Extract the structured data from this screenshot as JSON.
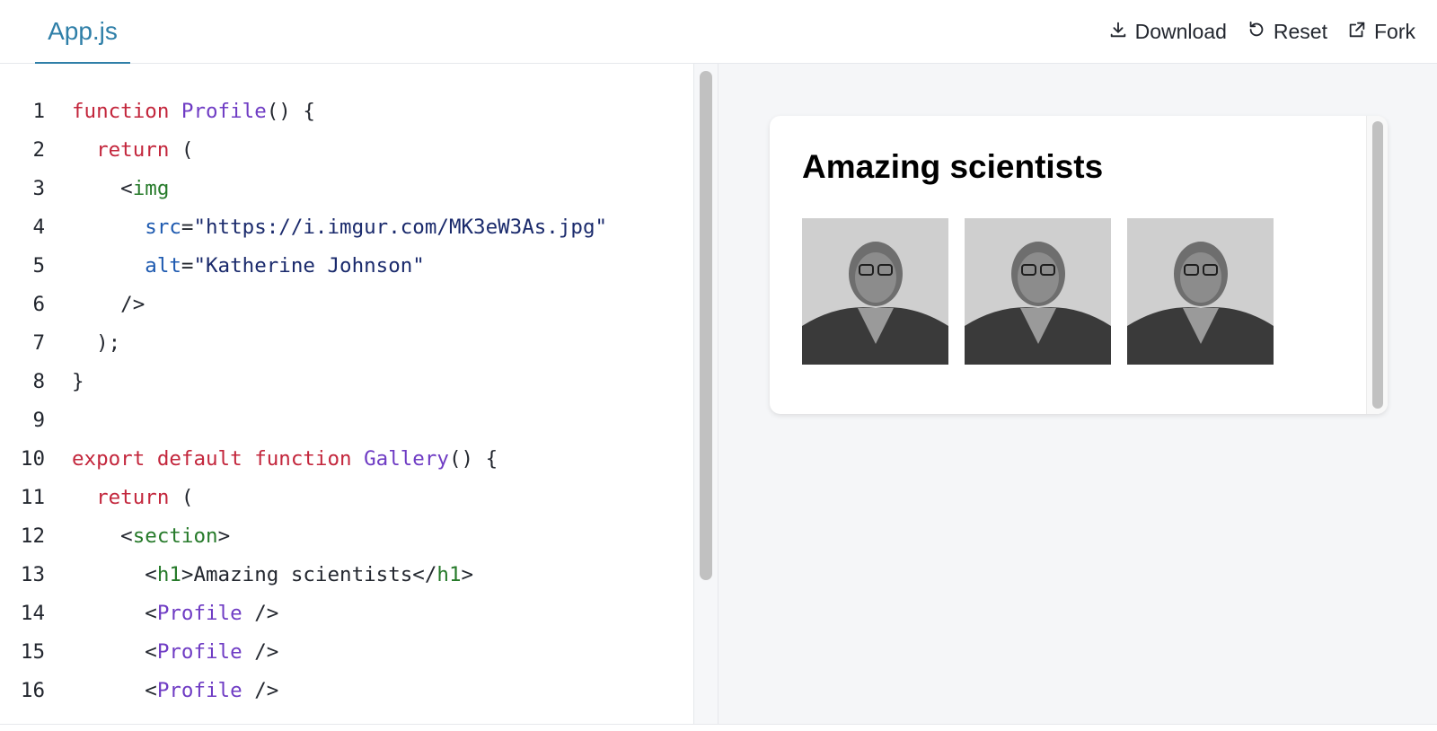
{
  "tabs": [
    {
      "label": "App.js"
    }
  ],
  "actions": {
    "download_label": "Download",
    "reset_label": "Reset",
    "fork_label": "Fork"
  },
  "editor": {
    "line_numbers": [
      "1",
      "2",
      "3",
      "4",
      "5",
      "6",
      "7",
      "8",
      "9",
      "10",
      "11",
      "12",
      "13",
      "14",
      "15",
      "16"
    ]
  },
  "preview": {
    "heading": "Amazing scientists",
    "images": [
      {
        "alt": "Katherine Johnson"
      },
      {
        "alt": "Katherine Johnson"
      },
      {
        "alt": "Katherine Johnson"
      }
    ]
  }
}
